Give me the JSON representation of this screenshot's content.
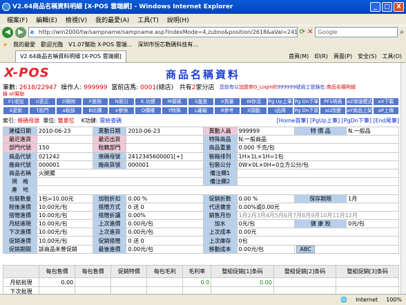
{
  "window": {
    "title": "V2.64商品名稱資料明細 [X-POS 雲端網] - Windows Internet Explorer",
    "min": "_",
    "max": "□",
    "close": "X"
  },
  "menu": [
    "檔案(F)",
    "編輯(E)",
    "檢視(V)",
    "我的最愛(A)",
    "工具(T)",
    "說明(H)"
  ],
  "address": {
    "url": "http://win2000/tw/sampname/sampname.asp?IndexMode=4,zubno&position/2618&aVal=2412345600001",
    "search_placeholder": "Google"
  },
  "favorites": {
    "label": "我的最愛",
    "items": [
      "歡迎光臨",
      "V1.07幫助 X-POS 雲端...",
      "深圳市恒芯數碼科技有..."
    ]
  },
  "tab": {
    "label": "V2.64商品名稱資料明細 [X-POS 雲端網]",
    "tools": [
      "首頁(M)",
      "印(R)",
      "頁面(P)",
      "安全(S)",
      "工具(O)"
    ]
  },
  "page": {
    "logo": "X-POS",
    "title": "商品名稱資料",
    "info": {
      "count_label": "筆數:",
      "count": "2618/22947",
      "operator_label": "操作人:",
      "operator": "999999",
      "store_label": "當前店馬:",
      "store": "0001",
      "store_name": "(總店)",
      "total_label": "共有",
      "total": "2",
      "total_suffix": "家分店"
    },
    "notice": {
      "prefix": "您前有以",
      "link": "加盟商G_Login的",
      "mid": "999999號員工登錄在:",
      "store": "商品名稱明細"
    },
    "notice2": "錄 all幫助",
    "buttons_row1": [
      "F1增加",
      "U更正",
      "D刪除",
      "F查詢",
      "N索引",
      "K 功健",
      "M便碼",
      "S盤查",
      "V貨量",
      "W存活",
      "Pg Up上筆",
      "Pg Dn下筆",
      "PF1明表",
      "aZ增值模式",
      "aX下載"
    ],
    "buttons_row2": [
      "A更新",
      "T前門",
      "a稅部",
      "B比價",
      "e參換",
      "Q價權",
      "Y特殊",
      "L藏報",
      "R參考",
      "X調動",
      "I品牌",
      "Pg Dn下家",
      "aU改變",
      "aY商品上架",
      "aP上傳"
    ],
    "index": {
      "label": "索引:",
      "value": "條碼母號",
      "unit_label": "單位:",
      "unit": "雙單位",
      "k_label": "K功健:",
      "k": "需檢查碼",
      "links": "[Home首筆] [PgUp上筆] [PgDn下筆] [End尾筆]"
    },
    "fields": {
      "build_date_l": "建檔日期",
      "build_date": "2010-06-23",
      "change_date_l": "異動日期",
      "change_date": "2010-06-23",
      "change_person_l": "異動人員",
      "change_person": "999999",
      "special_l": "特 價 品",
      "special": "N.一般品",
      "latest_in_l": "最近進貨",
      "latest_out_l": "最近出貨",
      "special_goods_l": "特殊商品",
      "special_goods": "N.一般商品",
      "dept_code_l": "部門代號",
      "dept_code": "150",
      "tax_dept_l": "稅籍部門",
      "weight_l": "商品重量",
      "weight": "0.000 千克/包",
      "item_code_l": "商品代號",
      "item_code": "021242",
      "barcode_mother_l": "條碼母號",
      "barcode_mother": "2412345600001[+]",
      "arrange_l": "裝箱排列",
      "arrange": "1H×1L×1H=1包",
      "vendor_l": "廠商代號",
      "vendor": "000001",
      "vendor_no_l": "廠商貨號",
      "vendor_no": "000001",
      "pack_l": "包裝公分",
      "pack": "0W×0L×0H=0立方公分/包",
      "name_l": "商品名稱",
      "name": "火腿腸",
      "remark1_l": "備注欄1",
      "spec_l": "規　格",
      "remark2_l": "備注欄2",
      "origin_l": "產　地",
      "pack_qty_l": "包裝數量",
      "pack_qty": "1包=10.00元",
      "tax_disc_l": "加稅折扣",
      "tax_disc": "0.00 %",
      "promo_disc_l": "促銷折數",
      "promo_disc": "0.00 %",
      "shelf_l": "保存期限",
      "shelf": "1月",
      "tax_price_l": "稅後進價",
      "tax_price": "10.00元/包",
      "rebate_mode_l": "搭贈方式",
      "rebate_mode": "0 送 0",
      "agency_l": "代送傭金",
      "agency": "0.00%或0.00元",
      "rebate_price_l": "搭贈進價",
      "rebate_price": "10.00元/包",
      "rebate_disc_l": "搭贈折讓",
      "rebate_disc": "0.00%",
      "sale_month_l": "銷售月份",
      "sale_month": "1月2月3月4月5月6月7月8月9月10月11月12月",
      "month_price_l": "月結進現",
      "month_price": "10.00元/包",
      "last_in_l": "上次進價",
      "last_in": "0.00元/包",
      "tax_add_l": "加水",
      "tax_add": "0元/包",
      "health_l": "健 康 稅",
      "health": "0元/包",
      "next_price_l": "下次進價",
      "next_price": "10.00元/包",
      "next_in_l": "上次進貨",
      "next_in": "0.00元/包",
      "last_cost_l": "上次成本",
      "last_cost": "0.00元",
      "promo_price_l": "促銷進價",
      "promo_price": "10.00元/包",
      "promo_disc2_l": "促銷搭贈",
      "promo_disc2": "0 送 0",
      "last_stock_l": "上次庫存",
      "last_stock": "0包",
      "promo_period_l": "促銷期間",
      "promo_period": "該商品未曾促銷",
      "min_price_l": "最後進價",
      "min_price": "0.00元/包",
      "move_cost_l": "移動成本",
      "move_cost": "0.00元/包",
      "abc": "ABC"
    },
    "bottom": {
      "headers": [
        "",
        "每包售價",
        "每包售價",
        "促銷特價",
        "每包毛利",
        "毛利率",
        "整組促銷[1]条码",
        "整組促銷[2]条码",
        "整組促銷[3]条码"
      ],
      "row1": [
        "月結批現",
        "0.00",
        "",
        "",
        "",
        "0.0",
        "0.00",
        "",
        ""
      ],
      "row2": [
        "下次批現",
        "",
        "",
        "",
        "",
        "",
        "",
        "",
        ""
      ]
    }
  },
  "status": {
    "zone": "Internet",
    "zoom": "100%"
  }
}
